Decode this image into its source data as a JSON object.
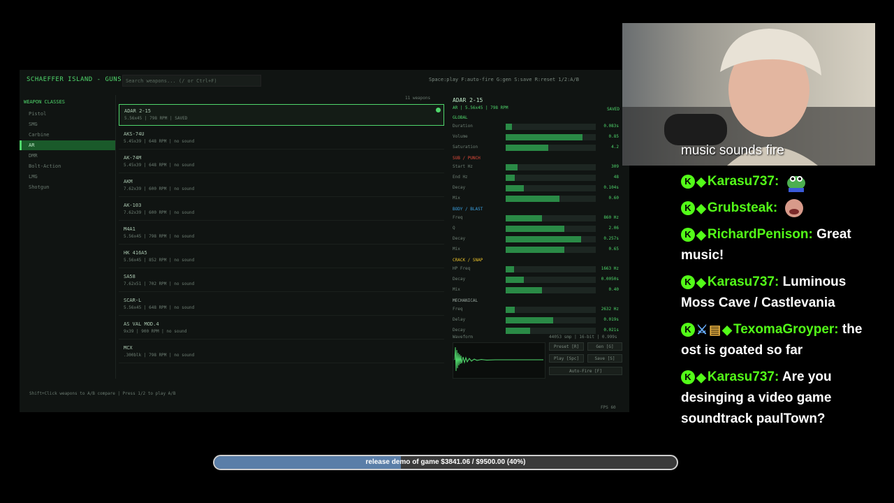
{
  "app": {
    "title": "SCHAEFFER ISLAND - GUNS",
    "search_placeholder": "Search weapons... (/ or Ctrl+F)",
    "shortcuts": "Space:play  F:auto-fire  G:gen  S:save  R:reset  1/2:A/B",
    "sidebar": {
      "heading": "WEAPON CLASSES",
      "items": [
        "Pistol",
        "SMG",
        "Carbine",
        "AR",
        "DMR",
        "Bolt-Action",
        "LMG",
        "Shotgun"
      ],
      "active_index": 3
    },
    "weapon_count": "11 weapons",
    "weapons": [
      {
        "name": "ADAR 2-15",
        "meta": "5.56x45  |  798 RPM  |  SAVED"
      },
      {
        "name": "AKS-74U",
        "meta": "5.45x39  |  648 RPM  |  no sound"
      },
      {
        "name": "AK-74M",
        "meta": "5.45x39  |  648 RPM  |  no sound"
      },
      {
        "name": "AKM",
        "meta": "7.62x39  |  600 RPM  |  no sound"
      },
      {
        "name": "AK-103",
        "meta": "7.62x39  |  600 RPM  |  no sound"
      },
      {
        "name": "M4A1",
        "meta": "5.56x45  |  798 RPM  |  no sound"
      },
      {
        "name": "HK 416A5",
        "meta": "5.56x45  |  852 RPM  |  no sound"
      },
      {
        "name": "SA58",
        "meta": "7.62x51  |  702 RPM  |  no sound"
      },
      {
        "name": "SCAR-L",
        "meta": "5.56x45  |  648 RPM  |  no sound"
      },
      {
        "name": "AS VAL MOD.4",
        "meta": "9x39  |  900 RPM  |  no sound"
      },
      {
        "name": "MCX",
        "meta": ".300blk  |  798 RPM  |  no sound"
      }
    ],
    "selected_weapon_index": 0,
    "editor": {
      "title": "ADAR 2-15",
      "subtitle": "AR  |  5.56x45  |  798 RPM",
      "saved": "SAVED",
      "sections": [
        {
          "label": "GLOBAL",
          "color": "#4fd66b",
          "params": [
            {
              "label": "Duration",
              "value": "0.083s",
              "fill": 0.07
            },
            {
              "label": "Volume",
              "value": "0.85",
              "fill": 0.85
            },
            {
              "label": "Saturation",
              "value": "4.2",
              "fill": 0.47
            }
          ]
        },
        {
          "label": "SUB / PUNCH",
          "color": "#e04a3a",
          "params": [
            {
              "label": "Start Hz",
              "value": "309",
              "fill": 0.13
            },
            {
              "label": "End Hz",
              "value": "48",
              "fill": 0.1
            },
            {
              "label": "Decay",
              "value": "0.104s",
              "fill": 0.2
            },
            {
              "label": "Mix",
              "value": "0.60",
              "fill": 0.6
            }
          ]
        },
        {
          "label": "BODY / BLAST",
          "color": "#3aa0e0",
          "params": [
            {
              "label": "Freq",
              "value": "860 Hz",
              "fill": 0.4
            },
            {
              "label": "Q",
              "value": "2.06",
              "fill": 0.65
            },
            {
              "label": "Decay",
              "value": "0.257s",
              "fill": 0.84
            },
            {
              "label": "Mix",
              "value": "0.65",
              "fill": 0.65
            }
          ]
        },
        {
          "label": "CRACK / SNAP",
          "color": "#e8c02a",
          "params": [
            {
              "label": "HP Freq",
              "value": "1663 Hz",
              "fill": 0.09
            },
            {
              "label": "Decay",
              "value": "0.0050s",
              "fill": 0.2
            },
            {
              "label": "Mix",
              "value": "0.40",
              "fill": 0.4
            }
          ]
        },
        {
          "label": "MECHANICAL",
          "color": "#9aa8a0",
          "params": [
            {
              "label": "Freq",
              "value": "2632 Hz",
              "fill": 0.1
            },
            {
              "label": "Delay",
              "value": "0.019s",
              "fill": 0.53
            },
            {
              "label": "Decay",
              "value": "0.021s",
              "fill": 0.27
            }
          ]
        }
      ],
      "waveform_label": "Waveform",
      "waveform_info": "44053 smp  |  16-bit  |  0.999s",
      "buttons": {
        "preset": "Preset [R]",
        "gen": "Gen [G]",
        "play": "Play [Spc]",
        "save": "Save [S]",
        "autofire": "Auto-Fire [F]"
      }
    },
    "footer": "Shift+Click weapons to A/B compare  |  Press 1/2 to play A/B",
    "fps": "FPS 60"
  },
  "webcam": {
    "caption": "music sounds fire"
  },
  "chat": [
    {
      "user": "Karasu737:",
      "text": "",
      "emote": "frog-emote"
    },
    {
      "user": "Grubsteak:",
      "text": "",
      "emote": "face-emote"
    },
    {
      "user": "RichardPenison:",
      "text": "Great music!"
    },
    {
      "user": "Karasu737:",
      "text": "Luminous Moss Cave / Castlevania"
    },
    {
      "user": "TexomaGroyper:",
      "text": "the ost is goated so far",
      "extra_icons": true
    },
    {
      "user": "Karasu737:",
      "text": "Are you desinging a video game soundtrack paulTown?"
    }
  ],
  "goal": {
    "text": "release demo of game $3841.06 / $9500.00 (40%)",
    "progress": 0.404,
    "fill_color": "#5a7ea8"
  }
}
